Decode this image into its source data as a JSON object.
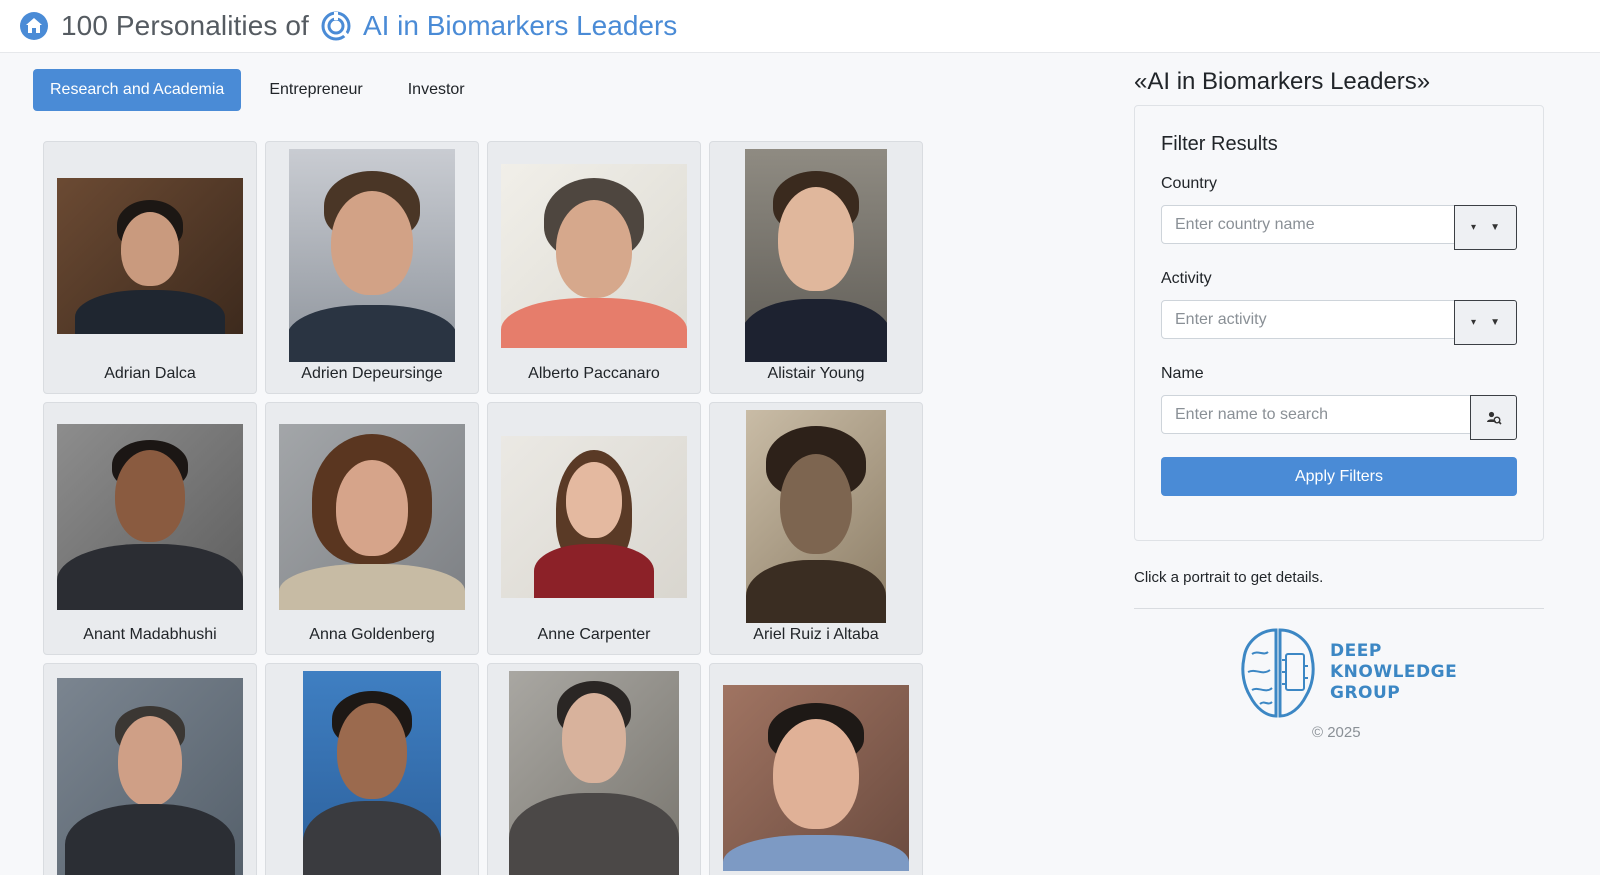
{
  "header": {
    "title_prefix": "100 Personalities of",
    "title_brand": "AI in Biomarkers Leaders"
  },
  "tabs": [
    {
      "label": "Research and Academia",
      "active": true
    },
    {
      "label": "Entrepreneur",
      "active": false
    },
    {
      "label": "Investor",
      "active": false
    }
  ],
  "people": [
    {
      "name": "Adrian Dalca"
    },
    {
      "name": "Adrien Depeursinge"
    },
    {
      "name": "Alberto Paccanaro"
    },
    {
      "name": "Alistair Young"
    },
    {
      "name": "Anant Madabhushi"
    },
    {
      "name": "Anna Goldenberg"
    },
    {
      "name": "Anne Carpenter"
    },
    {
      "name": "Ariel Ruiz i Altaba"
    },
    {
      "name": ""
    },
    {
      "name": ""
    },
    {
      "name": ""
    },
    {
      "name": ""
    }
  ],
  "sidebar": {
    "title": "«AI in Biomarkers Leaders»",
    "filter_title": "Filter Results",
    "country_label": "Country",
    "country_placeholder": "Enter country name",
    "activity_label": "Activity",
    "activity_placeholder": "Enter activity",
    "name_label": "Name",
    "name_placeholder": "Enter name to search",
    "apply_label": "Apply Filters",
    "hint": "Click a portrait to get details.",
    "logo_line1": "DEEP",
    "logo_line2": "KNOWLEDGE",
    "logo_line3": "GROUP",
    "copyright": "© 2025"
  },
  "colors": {
    "accent": "#4a8bd6",
    "card_bg": "#e9ebee",
    "page_bg": "#f7f8fa"
  }
}
